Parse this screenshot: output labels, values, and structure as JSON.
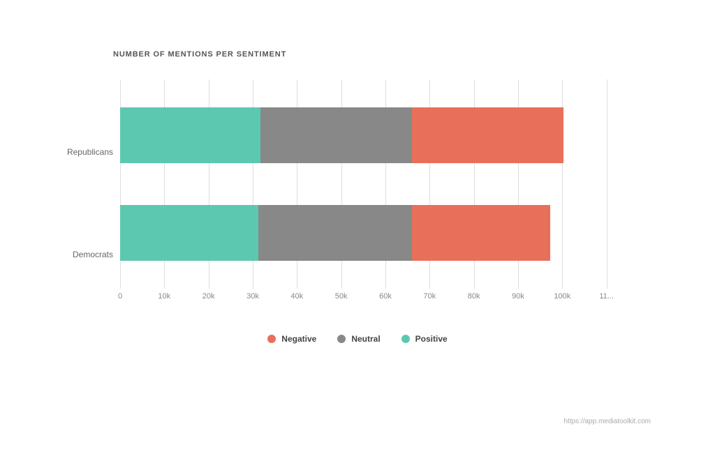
{
  "chart": {
    "title": "NUMBER OF MENTIONS PER SENTIMENT",
    "url": "https://app.mediatoolkit.com",
    "y_labels": [
      "Republicans",
      "Democrats"
    ],
    "x_ticks": [
      "0",
      "10k",
      "20k",
      "30k",
      "40k",
      "50k",
      "60k",
      "70k",
      "80k",
      "90k",
      "100k",
      "11..."
    ],
    "x_tick_positions": [
      0,
      8.33,
      16.66,
      25,
      33.33,
      41.66,
      50,
      58.33,
      66.66,
      75,
      83.33,
      91.66
    ],
    "bars": [
      {
        "label": "Republicans",
        "positive_pct": 26.5,
        "neutral_pct": 28.5,
        "negative_pct": 28.5
      },
      {
        "label": "Democrats",
        "positive_pct": 26,
        "neutral_pct": 29,
        "negative_pct": 26
      }
    ],
    "legend": [
      {
        "key": "negative",
        "label": "Negative",
        "color": "#e8705a"
      },
      {
        "key": "neutral",
        "label": "Neutral",
        "color": "#888888"
      },
      {
        "key": "positive",
        "label": "Positive",
        "color": "#5dc8b0"
      }
    ],
    "colors": {
      "positive": "#5dc8b0",
      "neutral": "#888888",
      "negative": "#e8705a"
    }
  }
}
